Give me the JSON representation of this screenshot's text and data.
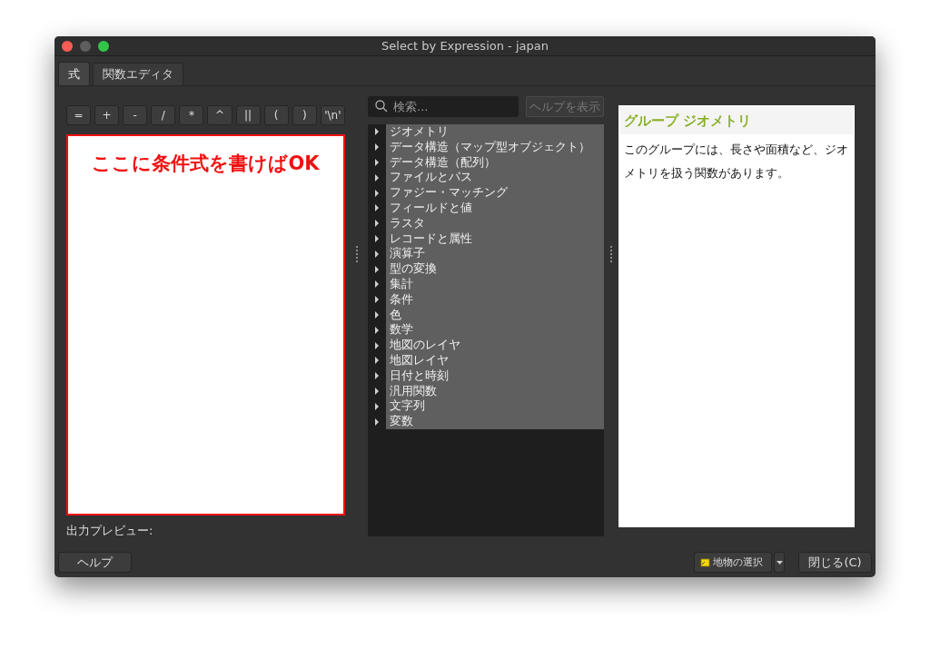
{
  "window": {
    "title": "Select by Expression - japan"
  },
  "tabs": [
    {
      "label": "式",
      "selected": true
    },
    {
      "label": "関数エディタ",
      "selected": false
    }
  ],
  "operators": [
    "=",
    "+",
    "-",
    "/",
    "*",
    "^",
    "||",
    "(",
    ")",
    "'\\n'"
  ],
  "editor": {
    "annotation": "ここに条件式を書けばOK"
  },
  "output_preview": {
    "label": "出力プレビュー:"
  },
  "search": {
    "placeholder": "検索..."
  },
  "show_help_button": {
    "label": "ヘルプを表示",
    "disabled": true
  },
  "function_groups": [
    {
      "label": "ジオメトリ",
      "expanded": false
    },
    {
      "label": "データ構造（マップ型オブジェクト）",
      "expanded": false
    },
    {
      "label": "データ構造（配列）",
      "expanded": false
    },
    {
      "label": "ファイルとパス",
      "expanded": false
    },
    {
      "label": "ファジー・マッチング",
      "expanded": false
    },
    {
      "label": "フィールドと値",
      "expanded": false
    },
    {
      "label": "ラスタ",
      "expanded": false
    },
    {
      "label": "レコードと属性",
      "expanded": false
    },
    {
      "label": "演算子",
      "expanded": false
    },
    {
      "label": "型の変換",
      "expanded": false
    },
    {
      "label": "集計",
      "expanded": false
    },
    {
      "label": "条件",
      "expanded": false
    },
    {
      "label": "色",
      "expanded": false
    },
    {
      "label": "数学",
      "expanded": false
    },
    {
      "label": "地図のレイヤ",
      "expanded": false
    },
    {
      "label": "地図レイヤ",
      "expanded": false
    },
    {
      "label": "日付と時刻",
      "expanded": false
    },
    {
      "label": "汎用関数",
      "expanded": false
    },
    {
      "label": "文字列",
      "expanded": false
    },
    {
      "label": "変数",
      "expanded": false
    }
  ],
  "help_panel": {
    "heading": "グループ ジオメトリ",
    "text": "このグループには、長さや面積など、ジオメトリを扱う関数があります。"
  },
  "footer": {
    "help_button": "ヘルプ",
    "select_features_button": "地物の選択",
    "close_button": "閉じる(C)"
  }
}
